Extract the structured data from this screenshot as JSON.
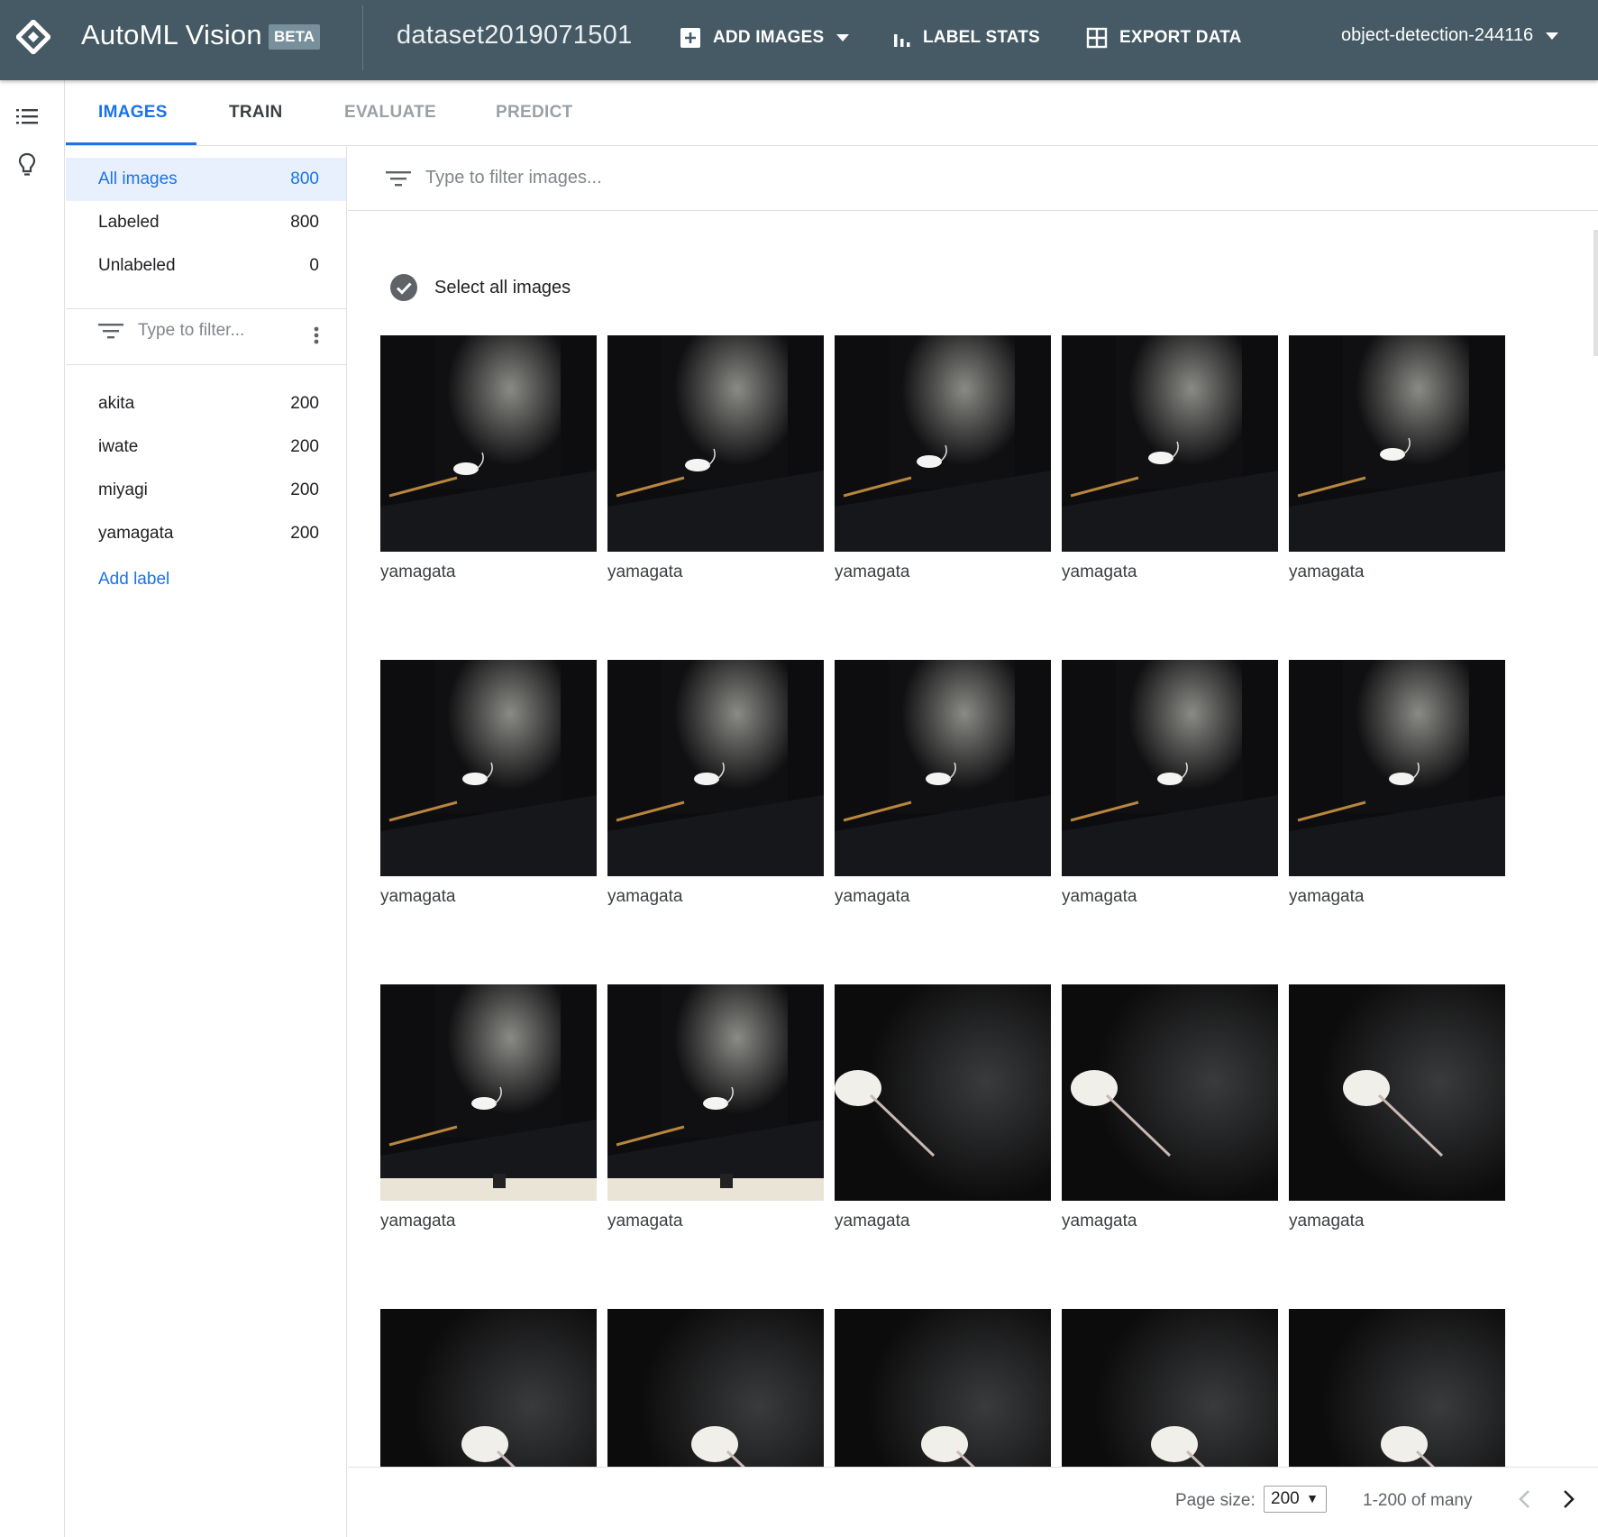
{
  "header": {
    "app_name": "AutoML Vision",
    "beta_badge": "BETA",
    "dataset_name": "dataset2019071501",
    "add_images": "ADD IMAGES",
    "label_stats": "LABEL STATS",
    "export_data": "EXPORT DATA",
    "project": "object-detection-244116",
    "bg_color": "#455a64"
  },
  "rail": {
    "icons": [
      "list-icon",
      "lightbulb-icon"
    ]
  },
  "tabs": [
    {
      "label": "IMAGES",
      "state": "active"
    },
    {
      "label": "TRAIN",
      "state": "normal"
    },
    {
      "label": "EVALUATE",
      "state": "disabled"
    },
    {
      "label": "PREDICT",
      "state": "disabled"
    }
  ],
  "sidebar": {
    "status_items": [
      {
        "label": "All images",
        "count": "800"
      },
      {
        "label": "Labeled",
        "count": "800"
      },
      {
        "label": "Unlabeled",
        "count": "0"
      }
    ],
    "filter_placeholder": "Type to filter...",
    "labels": [
      {
        "label": "akita",
        "count": "200"
      },
      {
        "label": "iwate",
        "count": "200"
      },
      {
        "label": "miyagi",
        "count": "200"
      },
      {
        "label": "yamagata",
        "count": "200"
      }
    ],
    "add_label": "Add label"
  },
  "main": {
    "filter_placeholder": "Type to filter images...",
    "select_all": "Select all images",
    "images": [
      "yamagata",
      "yamagata",
      "yamagata",
      "yamagata",
      "yamagata",
      "yamagata",
      "yamagata",
      "yamagata",
      "yamagata",
      "yamagata",
      "yamagata",
      "yamagata",
      "yamagata",
      "yamagata",
      "yamagata",
      "",
      "",
      "",
      "",
      ""
    ]
  },
  "footer": {
    "page_size_label": "Page size:",
    "page_size_value": "200",
    "range": "1-200 of many"
  },
  "colors": {
    "accent": "#1a73e8",
    "selected_bg": "#e8f0fe"
  }
}
